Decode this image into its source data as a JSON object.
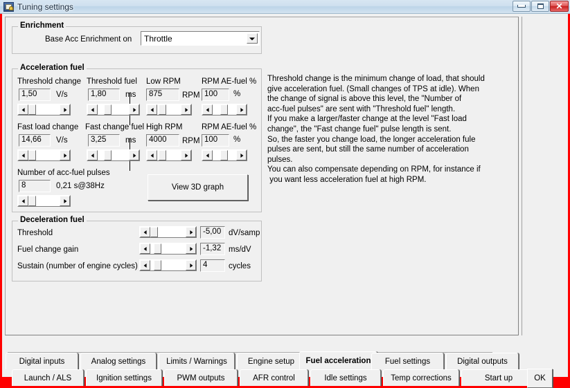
{
  "window": {
    "title": "Tuning settings",
    "icon": "app-icon",
    "buttons": {
      "minimize": "minimize",
      "maximize": "maximize",
      "close": "close"
    }
  },
  "enrichment": {
    "title": "Enrichment",
    "base_label": "Base Acc Enrichment on",
    "combo_value": "Throttle"
  },
  "acceleration_fuel": {
    "title": "Acceleration fuel",
    "fields": [
      {
        "label": "Threshold change",
        "value": "1,50",
        "unit": "V/s"
      },
      {
        "label": "Threshold fuel",
        "value": "1,80",
        "unit": "ms"
      },
      {
        "label": "Low RPM",
        "value": "875",
        "unit": "RPM"
      },
      {
        "label": "RPM AE-fuel %",
        "value": "100",
        "unit": "%"
      },
      {
        "label": "Fast load change",
        "value": "14,66",
        "unit": "V/s"
      },
      {
        "label": "Fast change fuel",
        "value": "3,25",
        "unit": "ms"
      },
      {
        "label": "High RPM",
        "value": "4000",
        "unit": "RPM"
      },
      {
        "label": "RPM AE-fuel %",
        "value": "100",
        "unit": "%"
      }
    ],
    "pulses": {
      "label": "Number of acc-fuel pulses",
      "value": "8",
      "info": "0,21 s@38Hz"
    },
    "view_3d_button": "View 3D graph"
  },
  "deceleration_fuel": {
    "title": "Deceleration fuel",
    "rows": [
      {
        "label": "Threshold",
        "value": "-5,00",
        "unit": "dV/samp"
      },
      {
        "label": "Fuel change gain",
        "value": "-1,32",
        "unit": "ms/dV"
      },
      {
        "label": "Sustain (number of engine cycles)",
        "value": "4",
        "unit": "cycles"
      }
    ]
  },
  "help_text": "Threshold change is the minimum change of load, that should\ngive acceleration fuel. (Small changes of TPS at idle). When\nthe change of signal is above this level, the \"Number of\nacc-fuel pulses\" are sent with \"Threshold fuel\" length.\nIf you make a larger/faster change at the level \"Fast load\nchange\", the \"Fast change fuel\" pulse length is sent.\nSo, the faster you change load, the longer acceleration fule\npulses are sent, but still the same number of acceleration\npulses.\nYou can also compensate depending on RPM, for instance if\n you want less acceleration fuel at high RPM.",
  "tabs": {
    "row1": [
      {
        "label": "Digital inputs",
        "active": false
      },
      {
        "label": "Analog settings",
        "active": false
      },
      {
        "label": "Limits / Warnings",
        "active": false
      },
      {
        "label": "Engine setup",
        "active": false
      },
      {
        "label": "Fuel acceleration",
        "active": true
      },
      {
        "label": "Fuel settings",
        "active": false
      },
      {
        "label": "Digital outputs",
        "active": false
      }
    ],
    "row2": [
      {
        "label": "Launch / ALS",
        "active": false
      },
      {
        "label": "Ignition settings",
        "active": false
      },
      {
        "label": "PWM outputs",
        "active": false
      },
      {
        "label": "AFR control",
        "active": false
      },
      {
        "label": "Idle settings",
        "active": false
      },
      {
        "label": "Temp corrections",
        "active": false
      },
      {
        "label": "Start up",
        "active": false
      }
    ]
  },
  "ok_button": "OK",
  "colors": {
    "frame": "#ff0000",
    "face": "#f0f0f0",
    "titlebar": "#cfe0ef"
  }
}
